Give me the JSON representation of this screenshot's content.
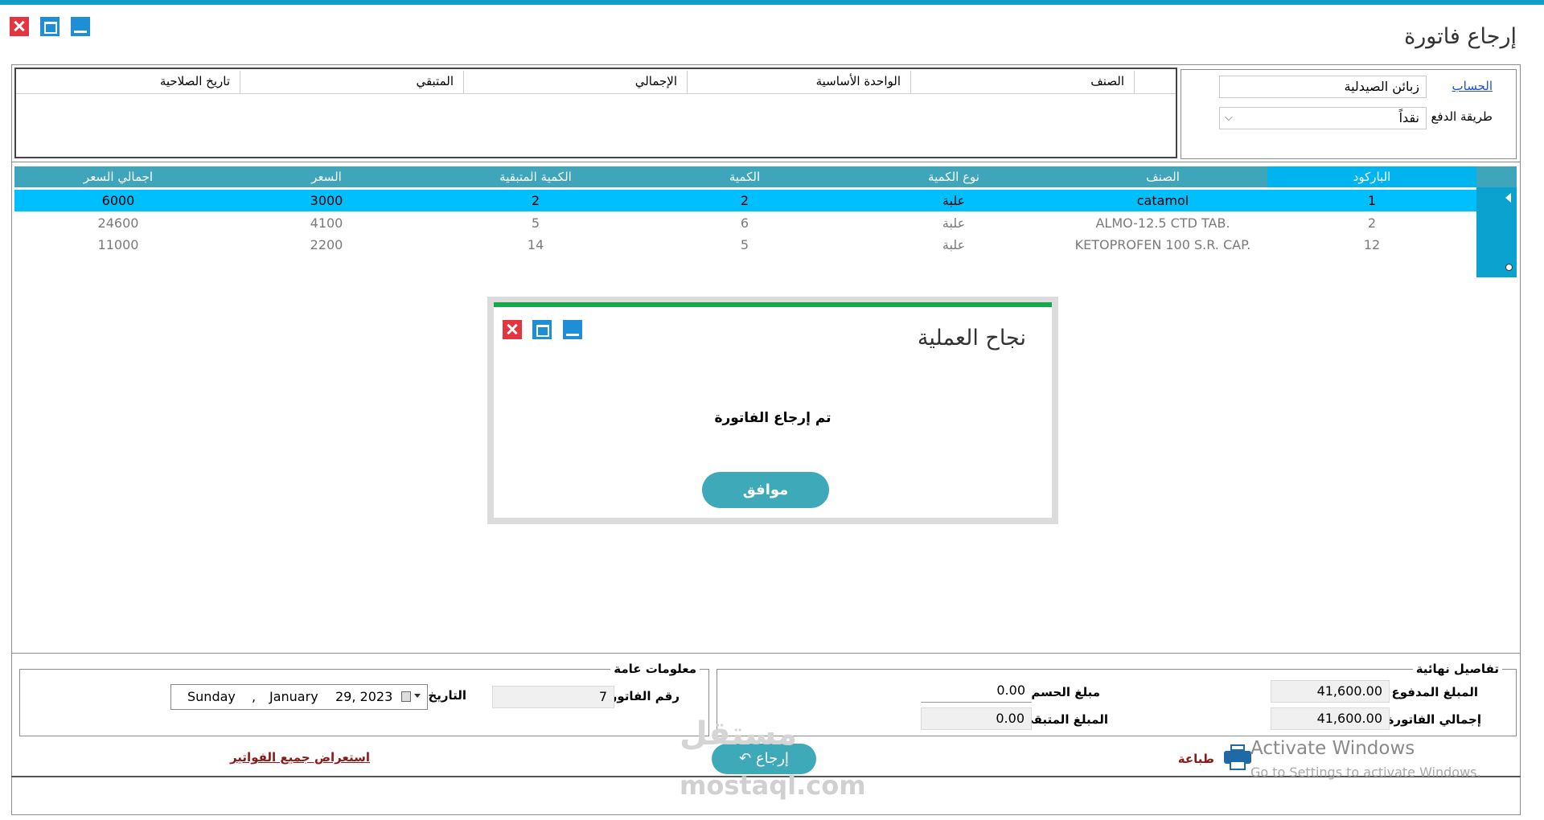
{
  "window": {
    "title": "إرجاع فاتورة"
  },
  "account": {
    "account_label": "الحساب",
    "account_value": "زبائن الصيدلية",
    "payment_label": "طريقة الدفع",
    "payment_value": "نقداً"
  },
  "details_table": {
    "headers": [
      "الصنف",
      "الواحدة الأساسية",
      "الإجمالي",
      "المتبقي",
      "تاريخ الصلاحية"
    ]
  },
  "items_grid": {
    "headers": [
      "الباركود",
      "الصنف",
      "نوع الكمية",
      "الكمية",
      "الكمية المتبقية",
      "السعر",
      "اجمالي السعر"
    ],
    "rows": [
      {
        "barcode": "1",
        "item": "catamol",
        "unit": "علبة",
        "qty": "2",
        "remaining": "2",
        "price": "3000",
        "total": "6000"
      },
      {
        "barcode": "2",
        "item": "ALMO-12.5 CTD TAB.",
        "unit": "علبة",
        "qty": "6",
        "remaining": "5",
        "price": "4100",
        "total": "24600"
      },
      {
        "barcode": "12",
        "item": "KETOPROFEN 100 S.R. CAP.",
        "unit": "علبة",
        "qty": "5",
        "remaining": "14",
        "price": "2200",
        "total": "11000"
      }
    ]
  },
  "dialog": {
    "title": "نجاح العملية",
    "message": "تم إرجاع الفاتورة",
    "ok_label": "موافق"
  },
  "final_details": {
    "section_label": "تفاصيل نهائية",
    "paid_label": "المبلغ المدفوع",
    "paid_value": "41,600.00",
    "invoice_total_label": "إجمالي الفاتورة",
    "invoice_total_value": "41,600.00",
    "discount_label": "مبلغ الحسم",
    "discount_value": "0.00",
    "remaining_label": "المبلغ المتبقي",
    "remaining_value": "0.00"
  },
  "general_info": {
    "section_label": "معلومات عامة",
    "invoice_number_label": "رقم الفاتورة",
    "invoice_number_value": "7",
    "date_label": "التاريخ",
    "date_day": "Sunday",
    "date_sep": ",",
    "date_month": "January",
    "date_rest": "29, 2023"
  },
  "actions": {
    "print_label": "طباعة",
    "return_label": "إرجاع",
    "view_all_label": "استعراض جميع الفواتير"
  },
  "overlay": {
    "activate_title": "Activate Windows",
    "activate_sub": "Go to Settings to activate Windows.",
    "watermark_ar": "مستقل",
    "watermark_en": "mostaql.com"
  }
}
